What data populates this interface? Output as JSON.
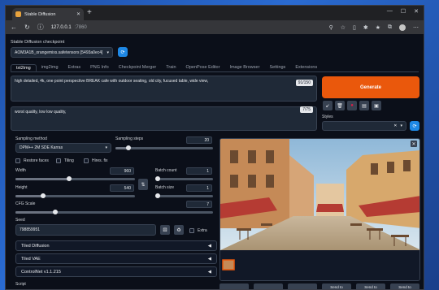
{
  "browser": {
    "tab_title": "Stable Diffusion",
    "new_tab": "+",
    "url_host": "127.0.0.1",
    "url_port": ":7860",
    "controls": [
      "—",
      "☐",
      "✕"
    ]
  },
  "checkpoint": {
    "label": "Stable Diffusion checkpoint",
    "value": "AOM3A1B_orangemixs.safetensors [5493a0ec4]"
  },
  "tabs": [
    "txt2img",
    "img2img",
    "Extras",
    "PNG Info",
    "Checkpoint Merger",
    "Train",
    "OpenPose Editor",
    "Image Browser",
    "Settings",
    "Extensions"
  ],
  "prompt": {
    "text": "high detailed, 4k, one point perspective BREAK cafe with outdoor seating, old city, fucused table, wide view,",
    "counter": "91/150"
  },
  "negative": {
    "text": "worst quality, low low quality,",
    "counter": "7/75"
  },
  "generate_label": "Generate",
  "styles_label": "Styles",
  "sampling": {
    "method_label": "Sampling method",
    "method_value": "DPM++ 2M SDE Karras",
    "steps_label": "Sampling steps",
    "steps_value": "20",
    "steps_fraction": 0.13
  },
  "options": {
    "restore_faces": "Restore faces",
    "tiling": "Tiling",
    "hires_fix": "Hires. fix"
  },
  "size": {
    "width_label": "Width",
    "width_value": "960",
    "width_fraction": 0.45,
    "height_label": "Height",
    "height_value": "540",
    "height_fraction": 0.23
  },
  "batch": {
    "count_label": "Batch count",
    "count_value": "1",
    "count_fraction": 0.0,
    "size_label": "Batch size",
    "size_value": "1",
    "size_fraction": 0.0
  },
  "cfg": {
    "label": "CFG Scale",
    "value": "7",
    "fraction": 0.2
  },
  "seed": {
    "label": "Seed",
    "value": "798859951",
    "extra_label": "Extra"
  },
  "accordions": [
    "Tiled Diffusion",
    "Tiled VAE",
    "ControlNet v1.1.215"
  ],
  "script_label": "Script",
  "bottom_buttons": [
    "",
    "",
    "",
    "Send to",
    "Send to",
    "Send to"
  ]
}
